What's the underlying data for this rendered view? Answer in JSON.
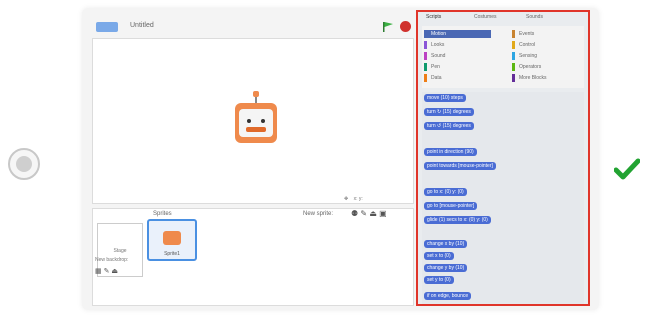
{
  "stage": {
    "version_badge_color": "#7aa9e8",
    "project_name": "Untitled",
    "flag_icon": "green-flag-icon",
    "stop_icon": "stop-icon",
    "sprite_label": "Sprite1"
  },
  "sprites": {
    "label": "Sprites",
    "new_sprite_label": "New sprite:",
    "stage_label": "Stage",
    "new_backdrop_label": "New backdrop:"
  },
  "palette": {
    "tabs": [
      "Scripts",
      "Costumes",
      "Sounds"
    ],
    "categories": [
      {
        "name": "Motion",
        "color": "#4a68b4",
        "active": true
      },
      {
        "name": "Looks",
        "color": "#8a55d7"
      },
      {
        "name": "Sound",
        "color": "#bb42c3"
      },
      {
        "name": "Pen",
        "color": "#0e9a6c"
      },
      {
        "name": "Data",
        "color": "#ee7d16"
      },
      {
        "name": "Events",
        "color": "#c88330"
      },
      {
        "name": "Control",
        "color": "#e1a91a"
      },
      {
        "name": "Sensing",
        "color": "#2ca5e2"
      },
      {
        "name": "Operators",
        "color": "#5cb712"
      },
      {
        "name": "More Blocks",
        "color": "#632d99"
      }
    ],
    "blocks": [
      "move (10) steps",
      "turn ↻ (15) degrees",
      "turn ↺ (15) degrees",
      "point in direction (90)",
      "point towards [mouse-pointer]",
      "go to x: (0) y: (0)",
      "go to [mouse-pointer]",
      "glide (1) secs to x: (0) y: (0)",
      "change x by (10)",
      "set x to (0)",
      "change y by (10)",
      "set y to (0)",
      "if on edge, bounce"
    ]
  },
  "status": {
    "check_color": "#22a332"
  }
}
